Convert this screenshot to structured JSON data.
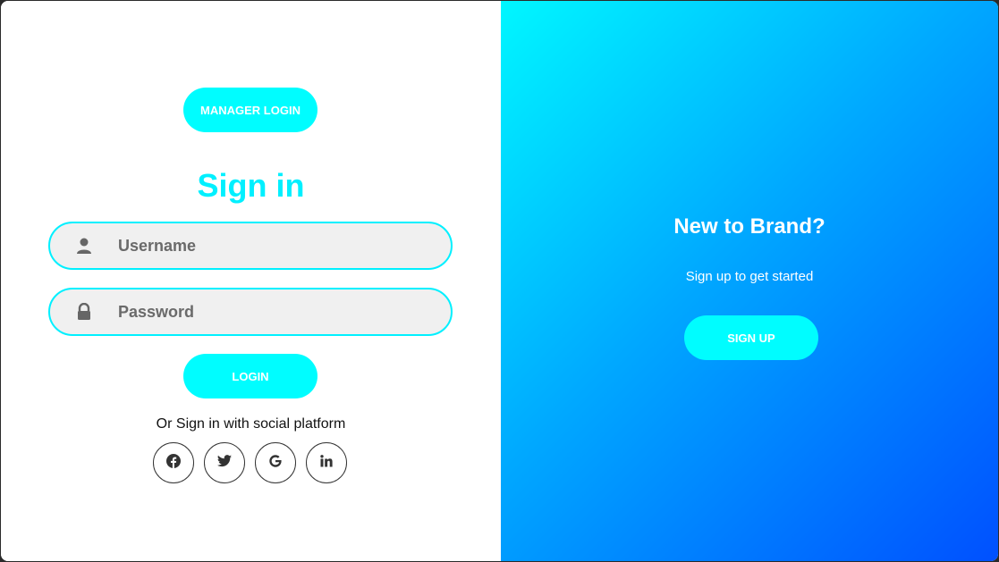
{
  "login_panel": {
    "manager_button_label": "MANAGER LOGIN",
    "title": "Sign in",
    "username": {
      "placeholder": "Username",
      "value": "",
      "icon": "user-icon"
    },
    "password": {
      "placeholder": "Password",
      "value": "",
      "icon": "lock-icon"
    },
    "login_button_label": "LOGIN",
    "social_text": "Or Sign in with social platform",
    "social_icons": [
      "facebook-icon",
      "twitter-icon",
      "google-icon",
      "linkedin-icon"
    ]
  },
  "signup_panel": {
    "title": "New to Brand?",
    "subtitle": "Sign up to get started",
    "signup_button_label": "SIGN UP"
  },
  "colors": {
    "accent": "#00fdff",
    "title_color": "#00f0ff",
    "gradient_start": "#00f7ff",
    "gradient_end": "#0050ff"
  }
}
